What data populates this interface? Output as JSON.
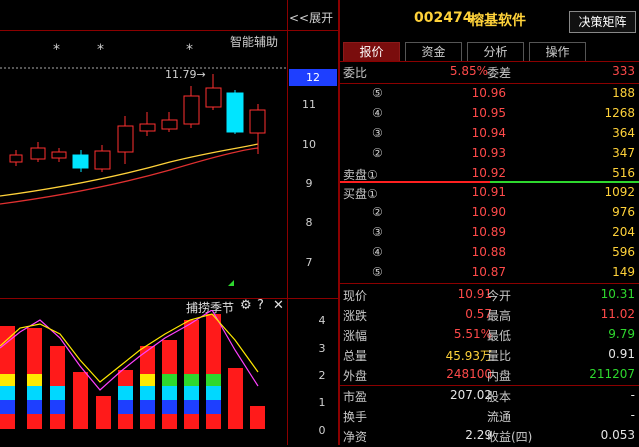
{
  "chart": {
    "expand_label": "<<展开",
    "assist_label": "智能辅助",
    "high_label": "11.79→",
    "price_tag": "12",
    "axis_ticks": [
      "11",
      "10",
      "9",
      "8",
      "7"
    ],
    "indicator_ticks": [
      "4",
      "3",
      "2",
      "1",
      "0"
    ],
    "indicator_title": "捕捞季节",
    "indicator_icons": [
      "gear-icon",
      "help-icon",
      "close-icon"
    ]
  },
  "stock": {
    "code": "002474",
    "name": "榕基软件",
    "decision_button": "决策矩阵"
  },
  "tabs": [
    "报价",
    "资金",
    "分析",
    "操作"
  ],
  "quote": {
    "wb_label": "委比",
    "wb_value": "5.85%",
    "wc_label": "委差",
    "wc_value": "333",
    "sell": [
      {
        "label": "⑤",
        "price": "10.96",
        "vol": "188"
      },
      {
        "label": "④",
        "price": "10.95",
        "vol": "1268"
      },
      {
        "label": "③",
        "price": "10.94",
        "vol": "364"
      },
      {
        "label": "②",
        "price": "10.93",
        "vol": "347"
      },
      {
        "label": "卖盘①",
        "price": "10.92",
        "vol": "516"
      }
    ],
    "buy": [
      {
        "label": "买盘①",
        "price": "10.91",
        "vol": "1092"
      },
      {
        "label": "②",
        "price": "10.90",
        "vol": "976"
      },
      {
        "label": "③",
        "price": "10.89",
        "vol": "204"
      },
      {
        "label": "④",
        "price": "10.88",
        "vol": "596"
      },
      {
        "label": "⑤",
        "price": "10.87",
        "vol": "149"
      }
    ],
    "stats": [
      {
        "l1": "现价",
        "v1": "10.91",
        "l2": "今开",
        "v2": "10.31",
        "c1": "red",
        "c2": "green"
      },
      {
        "l1": "涨跌",
        "v1": "0.57",
        "l2": "最高",
        "v2": "11.02",
        "c1": "red",
        "c2": "red"
      },
      {
        "l1": "涨幅",
        "v1": "5.51%",
        "l2": "最低",
        "v2": "9.79",
        "c1": "red",
        "c2": "green"
      },
      {
        "l1": "总量",
        "v1": "45.93万",
        "l2": "量比",
        "v2": "0.91",
        "c1": "yellow",
        "c2": "white"
      },
      {
        "l1": "外盘",
        "v1": "248100",
        "l2": "内盘",
        "v2": "211207",
        "c1": "red",
        "c2": "green"
      }
    ],
    "fund": [
      {
        "l1": "市盈",
        "v1": "207.02",
        "l2": "股本",
        "v2": "-"
      },
      {
        "l1": "换手",
        "v1": "-",
        "l2": "流通",
        "v2": "-"
      },
      {
        "l1": "净资",
        "v1": "2.29",
        "l2": "收益(四)",
        "v2": "0.053"
      }
    ]
  }
}
